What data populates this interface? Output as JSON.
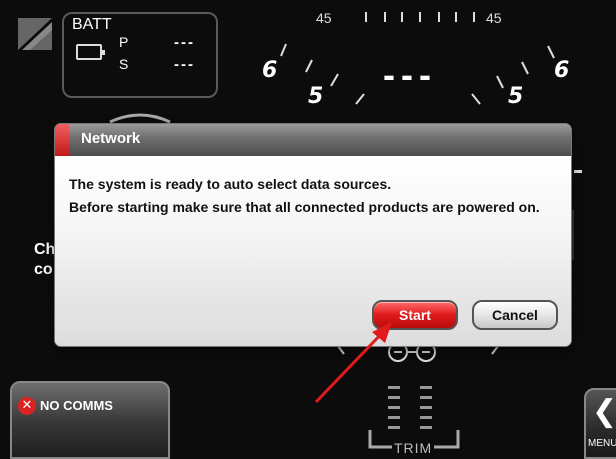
{
  "battery": {
    "title": "BATT",
    "port_label": "P",
    "port_value": "---",
    "starboard_label": "S",
    "starboard_value": "---"
  },
  "gauge": {
    "scale_left": "45",
    "scale_right": "45",
    "left_upper": "6",
    "left_lower": "5",
    "right_upper": "6",
    "right_lower": "5",
    "center_value": "---"
  },
  "background_text": {
    "line1": "Ch",
    "line2": "co"
  },
  "dialog": {
    "title": "Network",
    "message_line1": "The system is ready to auto select data sources.",
    "message_line2": "Before starting make sure that all connected products are powered on.",
    "start_label": "Start",
    "cancel_label": "Cancel"
  },
  "status": {
    "no_comms_label": "NO COMMS"
  },
  "menu": {
    "label": "MENU"
  },
  "trim": {
    "label": "TRIM"
  },
  "colors": {
    "accent_red": "#e01b1b",
    "background": "#0c0c0c"
  }
}
